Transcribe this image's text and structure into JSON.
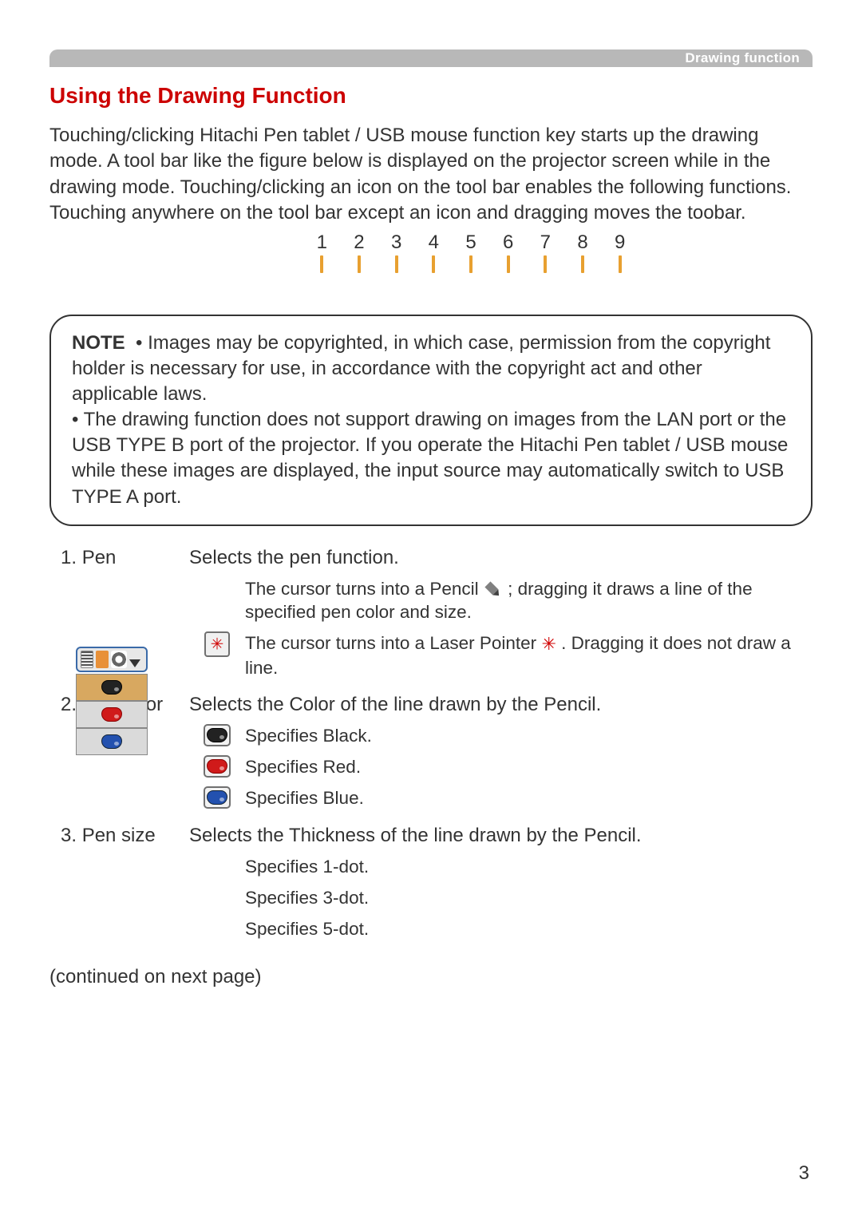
{
  "header": {
    "label": "Drawing function"
  },
  "section_title": "Using the Drawing Function",
  "intro_text": "Touching/clicking Hitachi Pen tablet / USB mouse function key starts up the drawing mode. A tool bar like the figure below is displayed on the projector screen while in the drawing mode. Touching/clicking an icon on the tool bar enables the following functions. Touching anywhere on the tool bar except an icon and dragging moves the toobar.",
  "toolbar_numbers": [
    "1",
    "2",
    "3",
    "4",
    "5",
    "6",
    "7",
    "8",
    "9"
  ],
  "note": {
    "label": "NOTE",
    "bullets": [
      "Images may be copyrighted, in which case, permission from the copyright holder is necessary for use, in accordance with the copyright act and other applicable laws.",
      "The drawing function does not support drawing on images from the LAN port or the USB TYPE B port of the projector. If you operate the Hitachi Pen tablet / USB mouse while these images are displayed, the input source may automatically switch to USB TYPE A port."
    ]
  },
  "definitions": [
    {
      "num": "1.",
      "term": "Pen",
      "desc": "Selects the pen function.",
      "subs": [
        {
          "icon": "pencil",
          "pre": "The cursor turns into a Pencil ",
          "post": "; dragging it draws a line of the specified pen color and size."
        },
        {
          "icon": "laser",
          "pre": "The cursor turns into a Laser Pointer  ",
          "post": ". Dragging it does not draw a line."
        }
      ]
    },
    {
      "num": "2.",
      "term": "Pen color",
      "desc": "Selects the Color of the line drawn by the Pencil.",
      "subs": [
        {
          "icon": "black",
          "text": "Specifies Black."
        },
        {
          "icon": "red",
          "text": "Specifies Red."
        },
        {
          "icon": "blue",
          "text": "Specifies Blue."
        }
      ]
    },
    {
      "num": "3.",
      "term": "Pen size",
      "desc": "Selects the Thickness of the line drawn by the Pencil.",
      "subs": [
        {
          "icon": "",
          "text": "Specifies 1-dot."
        },
        {
          "icon": "",
          "text": "Specifies 3-dot."
        },
        {
          "icon": "",
          "text": "Specifies 5-dot."
        }
      ]
    }
  ],
  "continued": "(continued on next page)",
  "page_number": "3"
}
